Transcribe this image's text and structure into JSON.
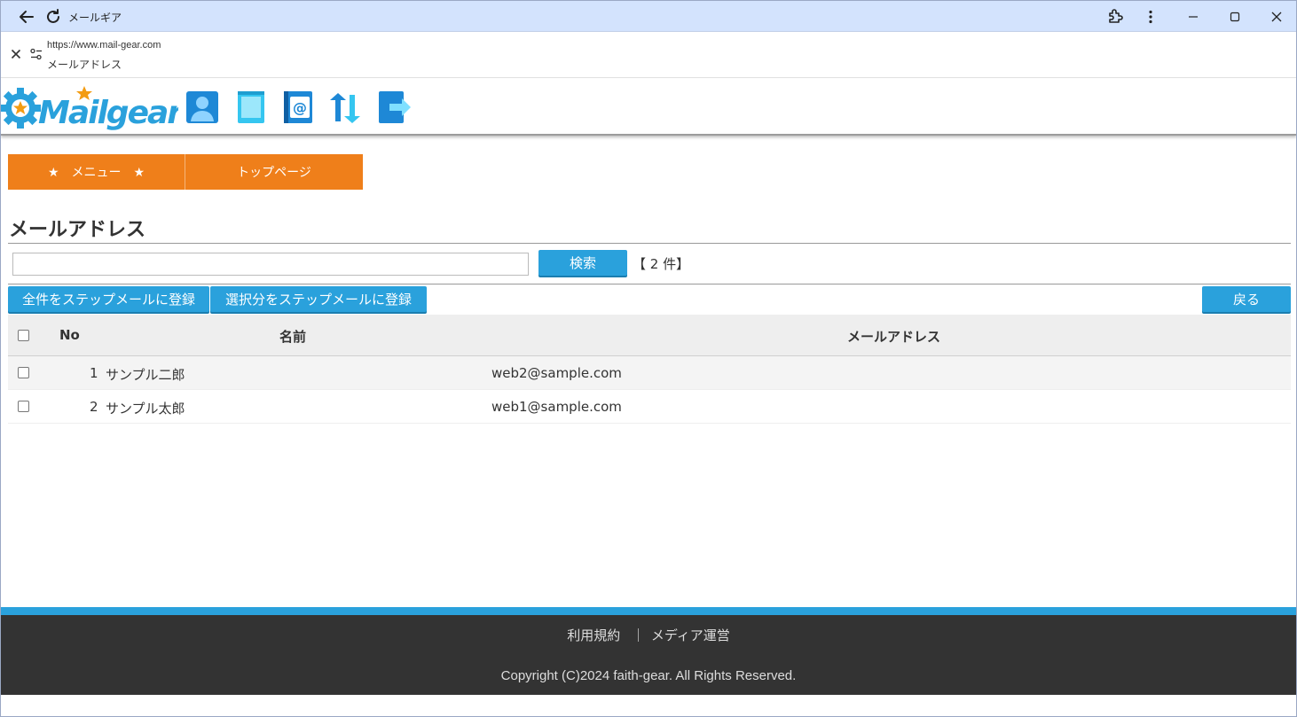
{
  "window": {
    "title": "メールギア"
  },
  "urlbar": {
    "url": "https://www.mail-gear.com",
    "page_name": "メールアドレス"
  },
  "header": {
    "logo_text": "Mailgear",
    "icons": [
      "user-icon",
      "book-icon",
      "address-book-icon",
      "sync-icon",
      "logout-icon"
    ]
  },
  "nav": {
    "items": [
      {
        "label": "★　メニュー　★"
      },
      {
        "label": "トップページ"
      }
    ]
  },
  "page": {
    "title": "メールアドレス"
  },
  "search": {
    "value": "",
    "button_label": "検索",
    "count_text": "【 2 件】"
  },
  "actions": {
    "register_all": "全件をステップメールに登録",
    "register_selected": "選択分をステップメールに登録",
    "back": "戻る"
  },
  "table": {
    "headers": {
      "no": "No",
      "name": "名前",
      "email": "メールアドレス"
    },
    "rows": [
      {
        "no": "1",
        "name": "サンプル二郎",
        "email": "web2@sample.com"
      },
      {
        "no": "2",
        "name": "サンプル太郎",
        "email": "web1@sample.com"
      }
    ]
  },
  "footer": {
    "terms": "利用規約",
    "separator": "｜",
    "media": "メディア運営",
    "copyright": "Copyright (C)2024 faith-gear. All Rights Reserved."
  },
  "colors": {
    "accent_blue": "#2aa1dc",
    "nav_orange": "#ef7f1a",
    "footer_dark": "#333333"
  }
}
